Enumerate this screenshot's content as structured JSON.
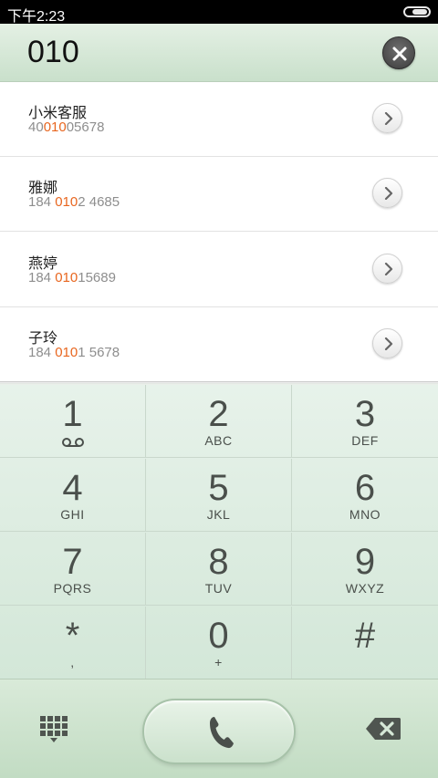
{
  "status_bar": {
    "time": "下午2:23",
    "battery_icon": "battery-icon"
  },
  "dial_input": {
    "value": "010",
    "clear_icon": "close-icon"
  },
  "results": [
    {
      "name": "小米客服",
      "number_before": "40",
      "number_match": "010",
      "number_after": "05678"
    },
    {
      "name": "雅娜",
      "number_before": "184 ",
      "number_match": "010",
      "number_after": "2 4685"
    },
    {
      "name": "燕婷",
      "number_before": "184 ",
      "number_match": "010",
      "number_after": "15689"
    },
    {
      "name": "子玲",
      "number_before": "184 ",
      "number_match": "010",
      "number_after": "1 5678"
    }
  ],
  "keypad": [
    {
      "digit": "1",
      "letters": ""
    },
    {
      "digit": "2",
      "letters": "ABC"
    },
    {
      "digit": "3",
      "letters": "DEF"
    },
    {
      "digit": "4",
      "letters": "GHI"
    },
    {
      "digit": "5",
      "letters": "JKL"
    },
    {
      "digit": "6",
      "letters": "MNO"
    },
    {
      "digit": "7",
      "letters": "PQRS"
    },
    {
      "digit": "8",
      "letters": "TUV"
    },
    {
      "digit": "9",
      "letters": "WXYZ"
    },
    {
      "digit": "*",
      "letters": ","
    },
    {
      "digit": "0",
      "letters": "+"
    },
    {
      "digit": "#",
      "letters": ""
    }
  ],
  "colors": {
    "match_highlight": "#e8661f",
    "keypad_text": "#4a4f4b",
    "header_green": "#c9e0cb"
  }
}
